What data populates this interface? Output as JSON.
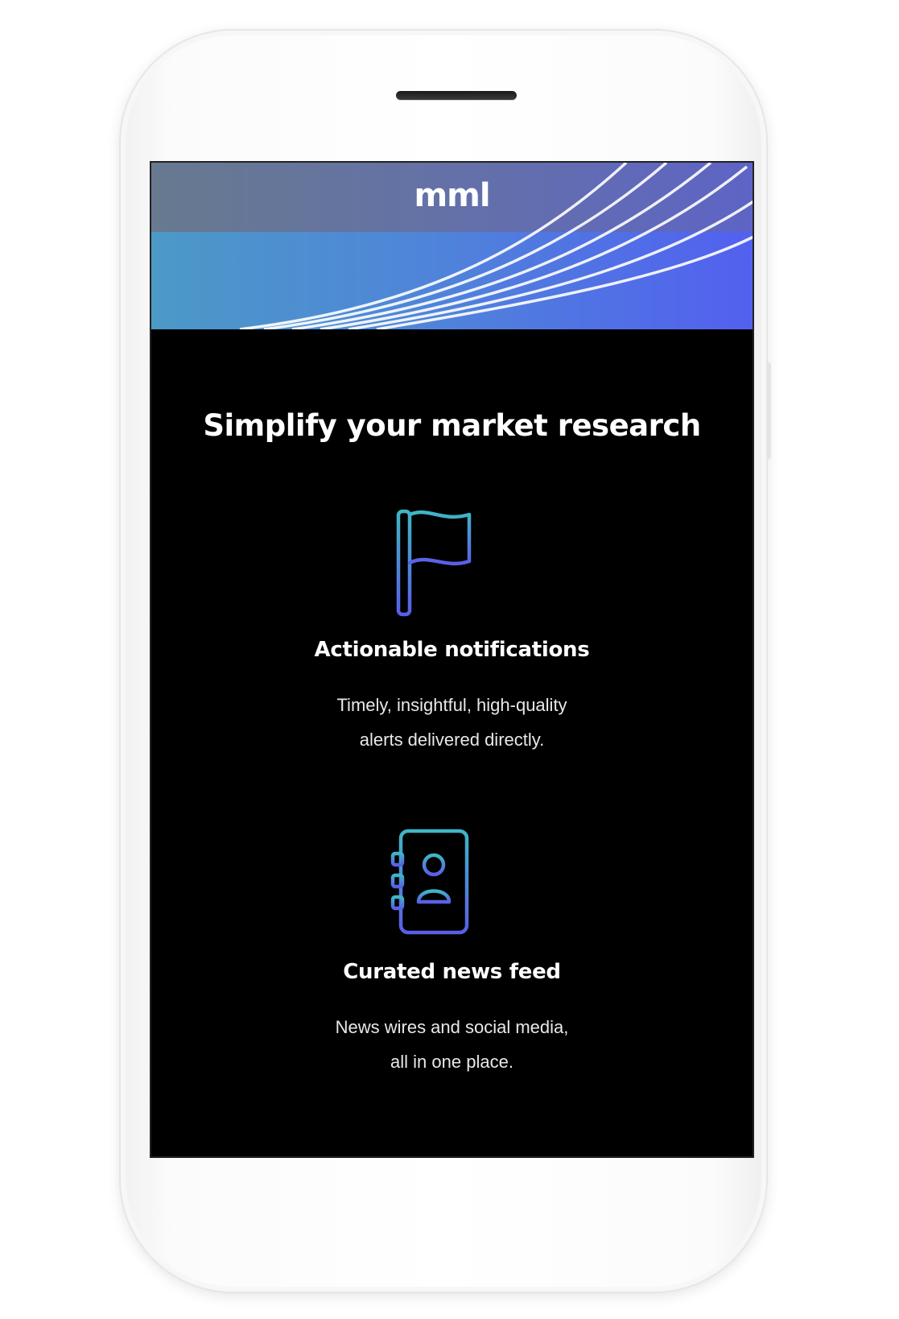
{
  "app": {
    "logo_text": "mml"
  },
  "hero": {
    "headline": "Simplify your market research"
  },
  "features": [
    {
      "icon": "flag-icon",
      "title": "Actionable notifications",
      "description_lines": [
        "Timely, insightful, high-quality",
        "alerts delivered directly."
      ]
    },
    {
      "icon": "contact-book-icon",
      "title": "Curated news feed",
      "description_lines": [
        "News wires and social media,",
        "all in one place."
      ]
    }
  ],
  "colors": {
    "screen_background": "#000000",
    "banner_gradient_start": "#4c99c7",
    "banner_gradient_end": "#5260ef",
    "icon_gradient_start": "#3fb6c6",
    "icon_gradient_end": "#5a5ee6",
    "phone_body": "#ffffff"
  }
}
